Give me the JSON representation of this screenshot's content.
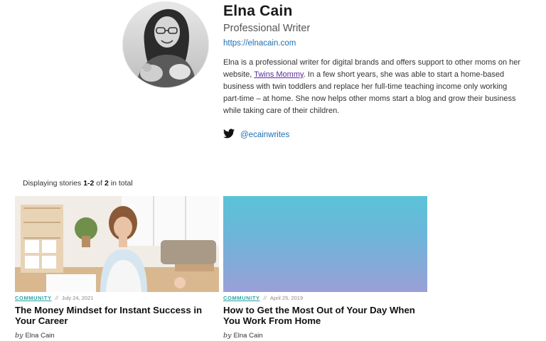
{
  "author": {
    "name": "Elna Cain",
    "role": "Professional Writer",
    "website": "https://elnacain.com",
    "bio_before": "Elna is a professional writer for digital brands and offers support to other moms on her website, ",
    "bio_link": "Twins Mommy",
    "bio_after": ". In a few short years, she was able to start a home-based business with twin toddlers and replace her full-time teaching income only working part-time – at home. She now helps other moms start a blog and grow their business while taking care of their children.",
    "twitter_handle": "@ecainwrites",
    "twitter_icon": "twitter-bird-icon"
  },
  "stories": {
    "label_prefix": "Displaying stories ",
    "range": "1-2",
    "label_mid": " of ",
    "total": "2",
    "label_suffix": " in total",
    "items": [
      {
        "category": "COMMUNITY",
        "separator": "//",
        "date": "July 24, 2021",
        "title": "The Money Mindset for Instant Success in Your Career",
        "by": "by",
        "author": "Elna Cain"
      },
      {
        "category": "COMMUNITY",
        "separator": "//",
        "date": "April 25, 2019",
        "title": "How to Get the Most Out of Your Day When You Work From Home",
        "by": "by",
        "author": "Elna Cain"
      }
    ]
  },
  "colors": {
    "link": "#1f6fb2",
    "visited_link": "#5b2a9c",
    "category": "#2aa4a4",
    "twitter": "#111111"
  }
}
